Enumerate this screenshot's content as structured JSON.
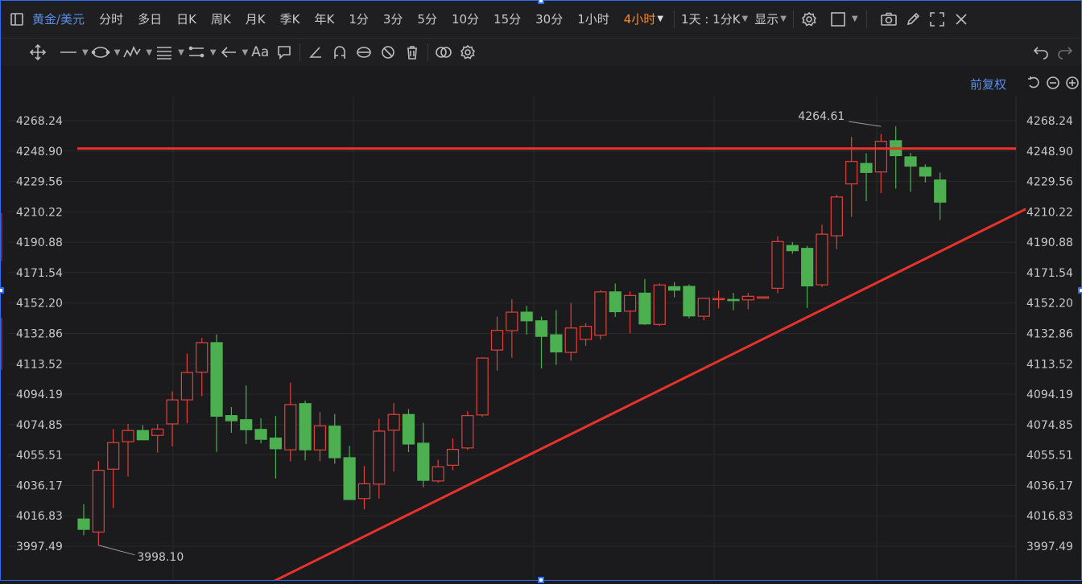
{
  "toolbar": {
    "symbol": "黄金/美元",
    "timeframes": [
      "分时",
      "多日",
      "日K",
      "周K",
      "月K",
      "季K",
      "年K",
      "1分",
      "3分",
      "5分",
      "10分",
      "15分",
      "30分",
      "1小时"
    ],
    "active_timeframe": "4小时",
    "period_setting": "1天 : 1分K",
    "display_label": "显示"
  },
  "drawing_tools": {
    "font_tool": "Aa"
  },
  "chart_header": {
    "adjust_label": "前复权"
  },
  "chart_data": {
    "type": "candlestick",
    "ylim": [
      3982,
      4283
    ],
    "y_ticks": [
      "4268.24",
      "4248.90",
      "4229.56",
      "4210.22",
      "4190.88",
      "4171.54",
      "4152.20",
      "4132.86",
      "4113.52",
      "4094.19",
      "4074.85",
      "4055.51",
      "4036.17",
      "4016.83",
      "3997.49"
    ],
    "y_tick_values": [
      4268.24,
      4248.9,
      4229.56,
      4210.22,
      4190.88,
      4171.54,
      4152.2,
      4132.86,
      4113.52,
      4094.19,
      4074.85,
      4055.51,
      4036.17,
      4016.83,
      3997.49
    ],
    "annotations": {
      "high_label": "4264.61",
      "high_value": 4264.61,
      "high_index": 54,
      "low_label": "3998.10",
      "low_value": 3998.1,
      "low_index": 1
    },
    "horizontal_line": {
      "value": 4250.5,
      "color": "#e8322b"
    },
    "trend_line": {
      "start_index": 9.6,
      "start_value": 3960.0,
      "end_index": 63.8,
      "end_value": 4212.0,
      "color": "#e8322b"
    },
    "colors": {
      "up": "#e0413a",
      "down": "#4caf50"
    },
    "candles": [
      {
        "o": 4014.8,
        "h": 4024.2,
        "l": 4004.5,
        "c": 4008.2
      },
      {
        "o": 4006.5,
        "h": 4051.6,
        "l": 3998.1,
        "c": 4045.8
      },
      {
        "o": 4046.5,
        "h": 4072.0,
        "l": 4021.7,
        "c": 4063.4
      },
      {
        "o": 4064.0,
        "h": 4075.3,
        "l": 4041.8,
        "c": 4071.1
      },
      {
        "o": 4071.1,
        "h": 4074.5,
        "l": 4064.9,
        "c": 4065.2
      },
      {
        "o": 4068.0,
        "h": 4075.2,
        "l": 4057.1,
        "c": 4072.0
      },
      {
        "o": 4075.3,
        "h": 4096.0,
        "l": 4061.0,
        "c": 4090.6
      },
      {
        "o": 4090.6,
        "h": 4120.0,
        "l": 4075.7,
        "c": 4108.0
      },
      {
        "o": 4108.2,
        "h": 4130.0,
        "l": 4092.9,
        "c": 4127.0
      },
      {
        "o": 4127.0,
        "h": 4132.2,
        "l": 4057.5,
        "c": 4080.2
      },
      {
        "o": 4080.6,
        "h": 4086.0,
        "l": 4069.7,
        "c": 4077.3
      },
      {
        "o": 4078.0,
        "h": 4099.7,
        "l": 4062.5,
        "c": 4071.6
      },
      {
        "o": 4071.8,
        "h": 4078.9,
        "l": 4062.9,
        "c": 4065.5
      },
      {
        "o": 4066.3,
        "h": 4080.3,
        "l": 4040.6,
        "c": 4059.5
      },
      {
        "o": 4058.8,
        "h": 4101.5,
        "l": 4051.5,
        "c": 4087.6
      },
      {
        "o": 4088.2,
        "h": 4090.1,
        "l": 4052.1,
        "c": 4058.8
      },
      {
        "o": 4058.7,
        "h": 4083.0,
        "l": 4051.6,
        "c": 4074.0
      },
      {
        "o": 4073.9,
        "h": 4081.6,
        "l": 4050.0,
        "c": 4053.8
      },
      {
        "o": 4053.8,
        "h": 4061.3,
        "l": 4027.2,
        "c": 4027.2
      },
      {
        "o": 4027.8,
        "h": 4048.4,
        "l": 4021.0,
        "c": 4037.2
      },
      {
        "o": 4037.0,
        "h": 4078.6,
        "l": 4027.8,
        "c": 4070.7
      },
      {
        "o": 4071.3,
        "h": 4088.5,
        "l": 4045.0,
        "c": 4081.3
      },
      {
        "o": 4081.3,
        "h": 4084.7,
        "l": 4057.3,
        "c": 4062.5
      },
      {
        "o": 4063.0,
        "h": 4076.0,
        "l": 4035.0,
        "c": 4039.4
      },
      {
        "o": 4039.0,
        "h": 4052.5,
        "l": 4037.8,
        "c": 4048.0
      },
      {
        "o": 4049.0,
        "h": 4066.0,
        "l": 4045.8,
        "c": 4059.1
      },
      {
        "o": 4060.0,
        "h": 4083.4,
        "l": 4058.7,
        "c": 4080.6
      },
      {
        "o": 4081.0,
        "h": 4117.7,
        "l": 4079.8,
        "c": 4117.2
      },
      {
        "o": 4122.3,
        "h": 4143.5,
        "l": 4109.2,
        "c": 4134.8
      },
      {
        "o": 4134.6,
        "h": 4154.6,
        "l": 4117.4,
        "c": 4146.4
      },
      {
        "o": 4146.4,
        "h": 4150.5,
        "l": 4132.1,
        "c": 4140.9
      },
      {
        "o": 4140.9,
        "h": 4143.6,
        "l": 4110.6,
        "c": 4131.0
      },
      {
        "o": 4132.0,
        "h": 4147.7,
        "l": 4112.9,
        "c": 4121.1
      },
      {
        "o": 4120.8,
        "h": 4152.3,
        "l": 4115.6,
        "c": 4136.3
      },
      {
        "o": 4129.1,
        "h": 4139.4,
        "l": 4125.0,
        "c": 4137.4
      },
      {
        "o": 4131.7,
        "h": 4160.3,
        "l": 4129.0,
        "c": 4159.3
      },
      {
        "o": 4159.3,
        "h": 4164.6,
        "l": 4143.4,
        "c": 4146.7
      },
      {
        "o": 4147.0,
        "h": 4159.6,
        "l": 4132.9,
        "c": 4157.0
      },
      {
        "o": 4158.5,
        "h": 4167.5,
        "l": 4138.3,
        "c": 4138.9
      },
      {
        "o": 4138.6,
        "h": 4164.7,
        "l": 4137.6,
        "c": 4163.7
      },
      {
        "o": 4162.6,
        "h": 4165.6,
        "l": 4155.8,
        "c": 4160.4
      },
      {
        "o": 4162.8,
        "h": 4164.0,
        "l": 4142.5,
        "c": 4144.0
      },
      {
        "o": 4143.8,
        "h": 4155.2,
        "l": 4141.2,
        "c": 4155.2
      },
      {
        "o": 4155.0,
        "h": 4160.1,
        "l": 4148.8,
        "c": 4155.1
      },
      {
        "o": 4154.5,
        "h": 4158.7,
        "l": 4147.6,
        "c": 4153.8
      },
      {
        "o": 4154.2,
        "h": 4158.7,
        "l": 4148.2,
        "c": 4156.5
      },
      {
        "o": 4155.9,
        "h": 4155.9,
        "l": 4155.0,
        "c": 4156.1
      },
      {
        "o": 4161.6,
        "h": 4194.7,
        "l": 4158.5,
        "c": 4191.3
      },
      {
        "o": 4188.8,
        "h": 4191.0,
        "l": 4183.5,
        "c": 4185.5
      },
      {
        "o": 4187.0,
        "h": 4188.6,
        "l": 4149.1,
        "c": 4163.1
      },
      {
        "o": 4163.8,
        "h": 4202.0,
        "l": 4162.3,
        "c": 4196.0
      },
      {
        "o": 4195.0,
        "h": 4221.2,
        "l": 4186.5,
        "c": 4219.7
      },
      {
        "o": 4228.0,
        "h": 4258.0,
        "l": 4207.0,
        "c": 4242.3
      },
      {
        "o": 4241.0,
        "h": 4247.5,
        "l": 4217.0,
        "c": 4235.3
      },
      {
        "o": 4235.6,
        "h": 4259.8,
        "l": 4222.2,
        "c": 4255.1
      },
      {
        "o": 4255.5,
        "h": 4264.6,
        "l": 4225.0,
        "c": 4246.0
      },
      {
        "o": 4245.2,
        "h": 4247.8,
        "l": 4223.0,
        "c": 4239.3
      },
      {
        "o": 4238.5,
        "h": 4240.5,
        "l": 4229.0,
        "c": 4233.0
      },
      {
        "o": 4230.5,
        "h": 4235.3,
        "l": 4205.0,
        "c": 4216.4
      }
    ]
  }
}
